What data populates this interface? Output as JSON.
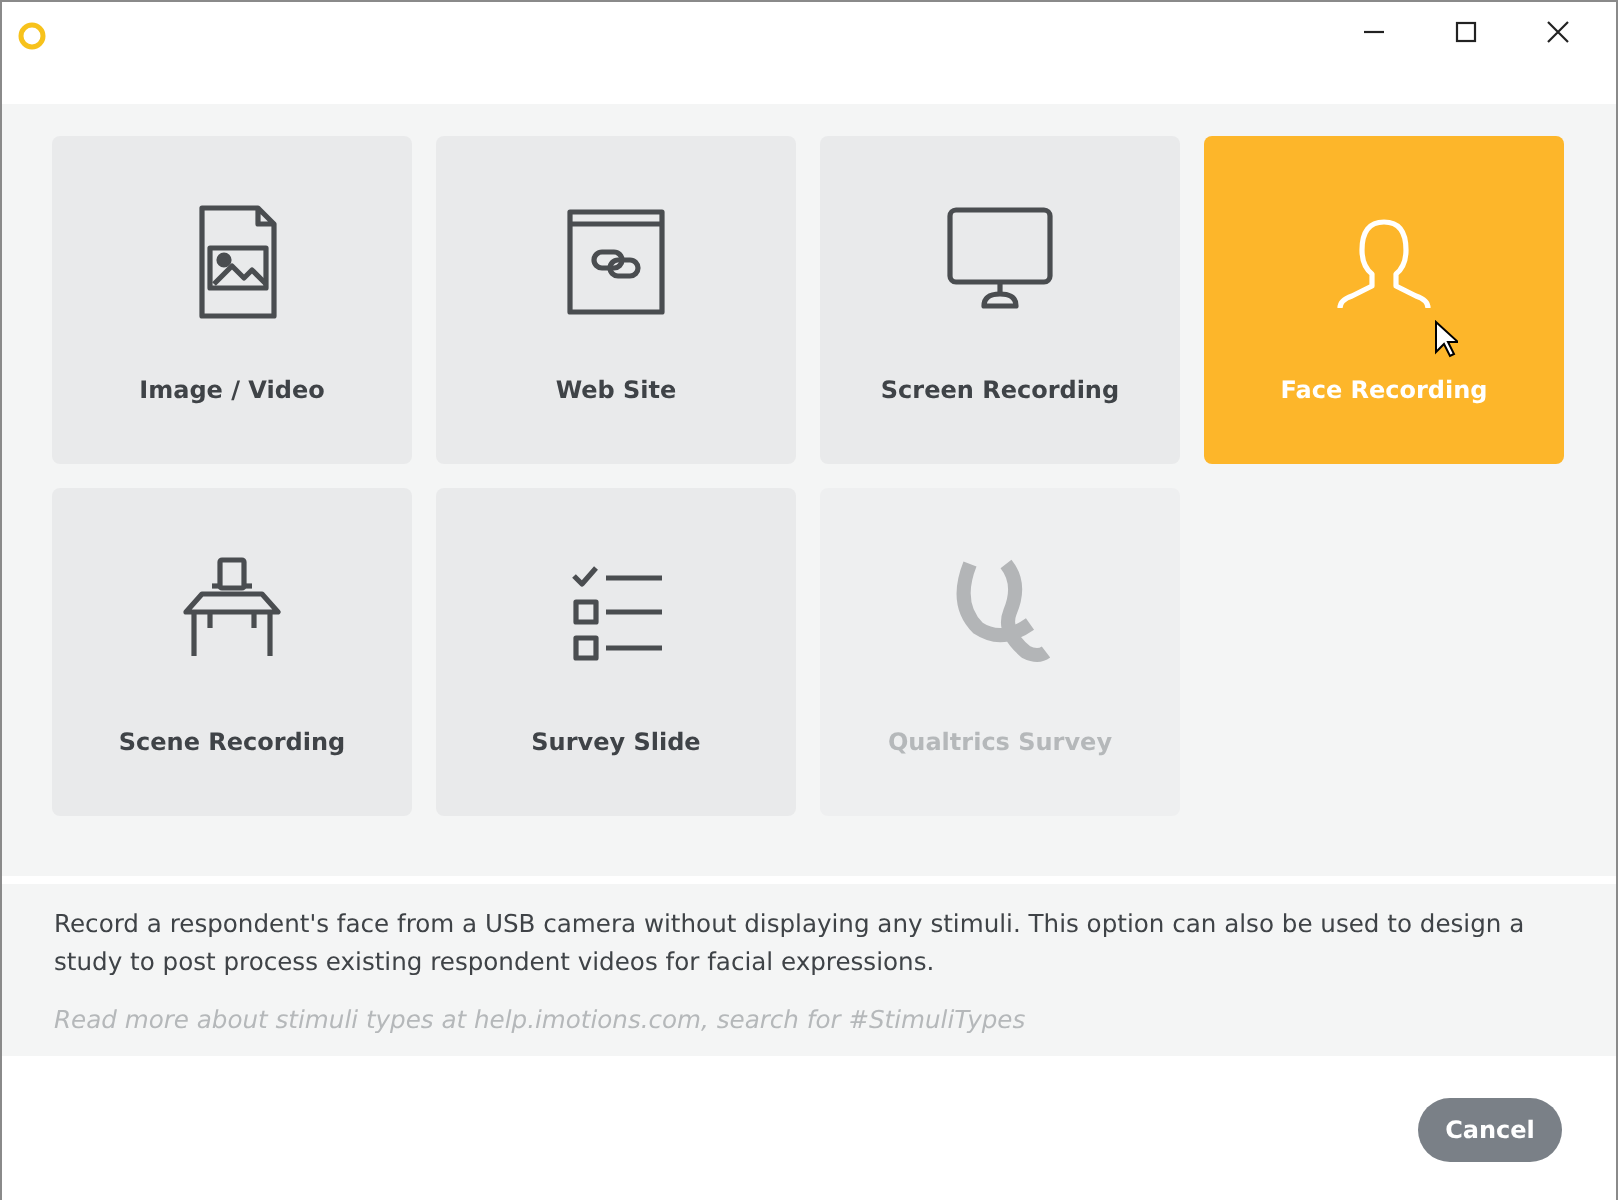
{
  "tiles": [
    {
      "label": "Image / Video",
      "kind": "image",
      "selected": false,
      "disabled": false
    },
    {
      "label": "Web Site",
      "kind": "web",
      "selected": false,
      "disabled": false
    },
    {
      "label": "Screen Recording",
      "kind": "screen",
      "selected": false,
      "disabled": false
    },
    {
      "label": "Face Recording",
      "kind": "face",
      "selected": true,
      "disabled": false
    },
    {
      "label": "Scene Recording",
      "kind": "scene",
      "selected": false,
      "disabled": false
    },
    {
      "label": "Survey Slide",
      "kind": "survey",
      "selected": false,
      "disabled": false
    },
    {
      "label": "Qualtrics Survey",
      "kind": "qualtrics",
      "selected": false,
      "disabled": true
    }
  ],
  "description": {
    "text": "Record a respondent's face from a USB camera without displaying any stimuli. This option can also be used to design a study to post process existing respondent videos for facial expressions.",
    "hint": "Read more about stimuli types at help.imotions.com, search for #StimuliTypes"
  },
  "buttons": [
    {
      "label": "Cancel"
    }
  ]
}
